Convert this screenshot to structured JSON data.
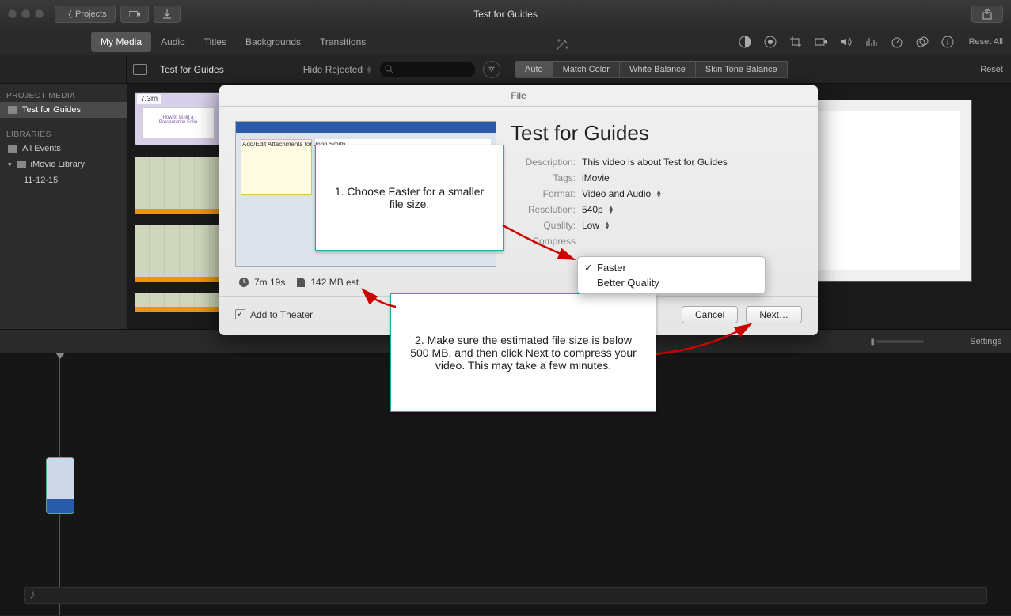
{
  "window": {
    "title": "Test for Guides",
    "projects_btn": "Projects"
  },
  "tabs": {
    "my_media": "My Media",
    "audio": "Audio",
    "titles": "Titles",
    "backgrounds": "Backgrounds",
    "transitions": "Transitions"
  },
  "tools": {
    "reset_all": "Reset All"
  },
  "seg": {
    "auto": "Auto",
    "match": "Match Color",
    "wb": "White Balance",
    "skin": "Skin Tone Balance",
    "reset": "Reset"
  },
  "subbar": {
    "clip": "Test for Guides",
    "hide_rej": "Hide Rejected"
  },
  "sidebar": {
    "hdr1": "PROJECT MEDIA",
    "proj": "Test for Guides",
    "hdr2": "LIBRARIES",
    "all_events": "All Events",
    "lib": "iMovie Library",
    "date": "11-12-15"
  },
  "clip": {
    "badge": "7.3m"
  },
  "timeline": {
    "settings": "Settings"
  },
  "dialog": {
    "title": "File",
    "heading": "Test for Guides",
    "desc_lbl": "Description:",
    "desc_val": "This video is about Test for Guides",
    "tags_lbl": "Tags:",
    "tags_val": "iMovie",
    "format_lbl": "Format:",
    "format_val": "Video and Audio",
    "res_lbl": "Resolution:",
    "res_val": "540p",
    "qual_lbl": "Quality:",
    "qual_val": "Low",
    "comp_lbl": "Compress",
    "duration": "7m 19s",
    "size": "142 MB est.",
    "add_theater": "Add to Theater",
    "cancel": "Cancel",
    "next": "Next…"
  },
  "menu": {
    "faster": "Faster",
    "better": "Better Quality"
  },
  "callouts": {
    "c1": "1. Choose Faster for a smaller file size.",
    "c2": "2. Make sure the estimated file size is below 500 MB, and then click Next to compress your video.  This may take a few minutes."
  }
}
